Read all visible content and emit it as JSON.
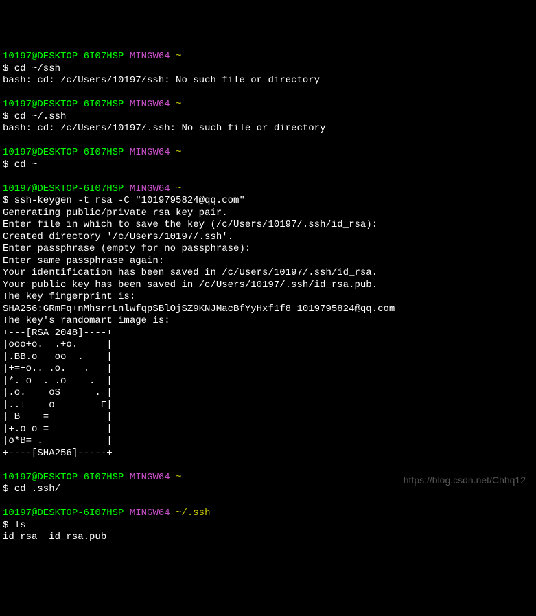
{
  "blocks": [
    {
      "prompt": {
        "user": "10197@DESKTOP-6I07HSP",
        "env": "MINGW64",
        "path": "~"
      },
      "cmd": "$ cd ~/ssh",
      "out": [
        "bash: cd: /c/Users/10197/ssh: No such file or directory",
        ""
      ]
    },
    {
      "prompt": {
        "user": "10197@DESKTOP-6I07HSP",
        "env": "MINGW64",
        "path": "~"
      },
      "cmd": "$ cd ~/.ssh",
      "out": [
        "bash: cd: /c/Users/10197/.ssh: No such file or directory",
        ""
      ]
    },
    {
      "prompt": {
        "user": "10197@DESKTOP-6I07HSP",
        "env": "MINGW64",
        "path": "~"
      },
      "cmd": "$ cd ~",
      "out": [
        ""
      ]
    },
    {
      "prompt": {
        "user": "10197@DESKTOP-6I07HSP",
        "env": "MINGW64",
        "path": "~"
      },
      "cmd": "$ ssh-keygen -t rsa -C \"1019795824@qq.com\"",
      "out": [
        "Generating public/private rsa key pair.",
        "Enter file in which to save the key (/c/Users/10197/.ssh/id_rsa):",
        "Created directory '/c/Users/10197/.ssh'.",
        "Enter passphrase (empty for no passphrase):",
        "Enter same passphrase again:",
        "Your identification has been saved in /c/Users/10197/.ssh/id_rsa.",
        "Your public key has been saved in /c/Users/10197/.ssh/id_rsa.pub.",
        "The key fingerprint is:",
        "SHA256:GRmFq+nMhsrrLnlwfqpSBlOjSZ9KNJMacBfYyHxf1f8 1019795824@qq.com",
        "The key's randomart image is:",
        "+---[RSA 2048]----+",
        "|ooo+o.  .+o.     |",
        "|.BB.o   oo  .    |",
        "|+=+o.. .o.   .   |",
        "|*. o  . .o    .  |",
        "|.o.    oS      . |",
        "|..+    o        E|",
        "| B    =          |",
        "|+.o o =          |",
        "|o*B= .           |",
        "+----[SHA256]-----+",
        ""
      ]
    },
    {
      "prompt": {
        "user": "10197@DESKTOP-6I07HSP",
        "env": "MINGW64",
        "path": "~"
      },
      "cmd": "$ cd .ssh/",
      "out": [
        ""
      ]
    },
    {
      "prompt": {
        "user": "10197@DESKTOP-6I07HSP",
        "env": "MINGW64",
        "path": "~/.ssh"
      },
      "cmd": "$ ls",
      "out": [
        "id_rsa  id_rsa.pub"
      ]
    }
  ],
  "watermark": "https://blog.csdn.net/Chhq12"
}
